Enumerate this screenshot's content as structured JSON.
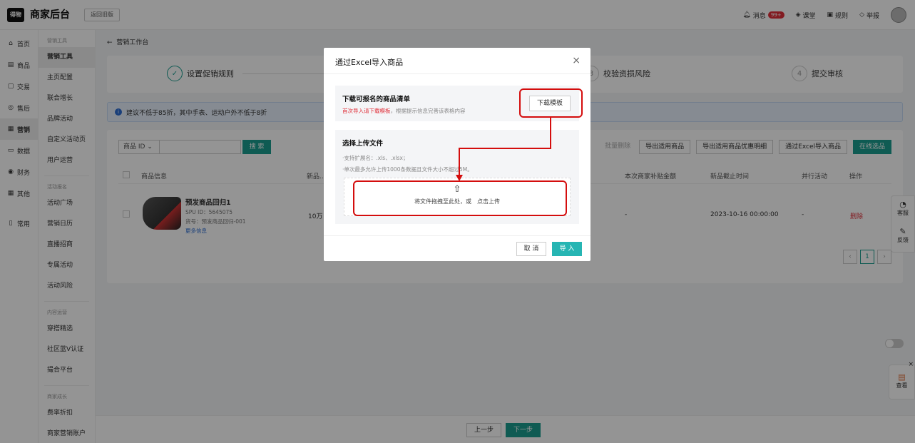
{
  "header": {
    "logo_text": "得物",
    "app_title": "商家后台",
    "old_version_button": "返回旧版",
    "messages_label": "消息",
    "messages_badge": "99+",
    "class_label": "课堂",
    "rules_label": "规则",
    "report_label": "举报"
  },
  "sidebar_main": {
    "items": [
      {
        "label": "首页",
        "icon": "home-icon"
      },
      {
        "label": "商品",
        "icon": "product-icon"
      },
      {
        "label": "交易",
        "icon": "trade-icon"
      },
      {
        "label": "售后",
        "icon": "aftersale-icon"
      },
      {
        "label": "营销",
        "icon": "marketing-icon"
      },
      {
        "label": "数据",
        "icon": "data-icon"
      },
      {
        "label": "财务",
        "icon": "finance-icon"
      },
      {
        "label": "其他",
        "icon": "other-icon"
      },
      {
        "label": "常用",
        "icon": "common-icon"
      }
    ],
    "active": "营销"
  },
  "sidebar_sub": {
    "group1": "营销工具",
    "group1_items": [
      "营销工具",
      "主页配置",
      "联合增长",
      "品牌活动",
      "自定义活动页",
      "用户运营"
    ],
    "group2": "活动报名",
    "group2_items": [
      "活动广场",
      "营销日历",
      "直播招商",
      "专属活动",
      "活动风险"
    ],
    "group3": "内容运营",
    "group3_items": [
      "穿搭精选",
      "社区蓝V认证",
      "撮合平台"
    ],
    "group4": "商家成长",
    "group4_items": [
      "费率折扣",
      "商家营销账户"
    ]
  },
  "main": {
    "back_label": "营销工作台",
    "steps": [
      {
        "label": "设置促销规则",
        "marker": "✓"
      },
      {
        "label": "校验资损风险",
        "marker": "3"
      },
      {
        "label": "提交审核",
        "marker": "4"
      }
    ],
    "tip": "建议不低于85折，其中手表、运动户外不低于8折",
    "filter": {
      "select": "商品 ID",
      "search_button": "搜 索"
    },
    "actions": [
      "批量删除",
      "导出适用商品",
      "导出适用商品优惠明细",
      "通过Excel导入商品",
      "在线选品"
    ],
    "table_headers": [
      "商品信息",
      "新品...",
      "本次商家补贴金额",
      "新品截止时间",
      "并行活动",
      "操作"
    ],
    "row": {
      "name": "预发商品回归1",
      "spu": "SPU ID：5645075",
      "sku": "货号：预发商品回归-001",
      "more": "更多信息",
      "new_col": "10万",
      "subsidy": "-",
      "deadline": "2023-10-16 00:00:00",
      "parallel": "-",
      "op": "删除"
    },
    "pagination": {
      "prev": "‹",
      "current": "1",
      "next": "›"
    }
  },
  "bottom": {
    "prev": "上一步",
    "next": "下一步"
  },
  "float_right": {
    "items": [
      "客服",
      "反馈"
    ],
    "view_label": "查看"
  },
  "modal": {
    "title": "通过Excel导入商品",
    "close": "×",
    "download_heading": "下载可报名的商品清单",
    "download_hint_red": "首次导入请下载模板",
    "download_hint_rest": "，根据提示信息完善该表格内容",
    "download_button": "下载模板",
    "upload_heading": "选择上传文件",
    "note1": "·支持扩展名：.xls、.xlsx；",
    "note2": "·单次最多允许上传1000条数据且文件大小不超过5M。",
    "drop_text": "将文件拖拽至此处，或　点击上传",
    "cancel": "取 消",
    "confirm": "导 入"
  },
  "colors": {
    "accent": "#1a9e8f",
    "danger": "#e0303a",
    "annotation": "#d40d0d",
    "link": "#2d6dd2"
  }
}
